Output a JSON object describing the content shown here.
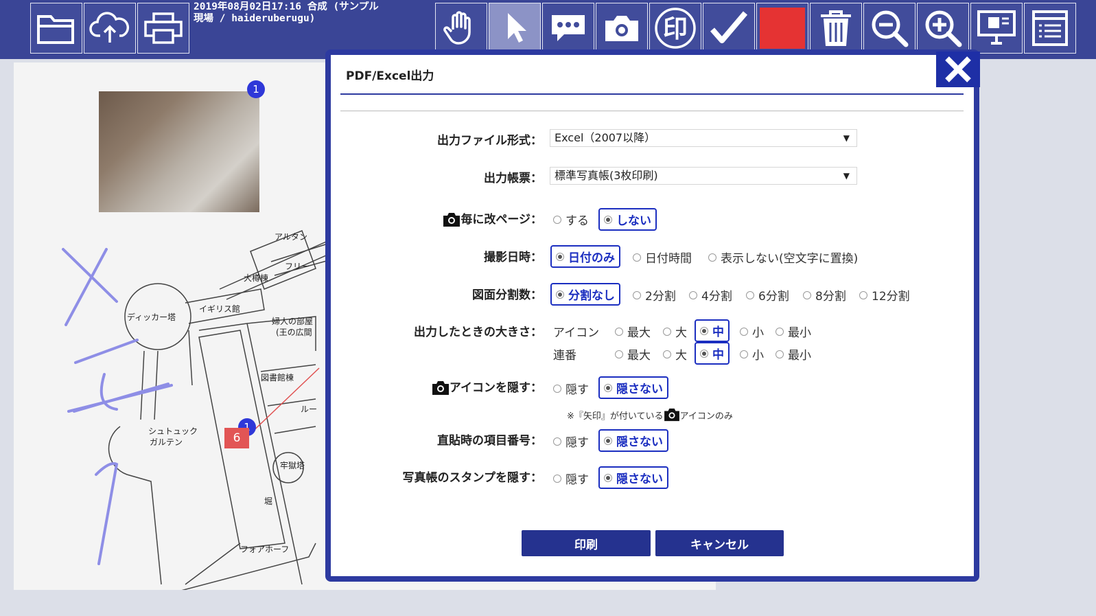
{
  "toolbar": {
    "title_line1": "2019年08月02日17:16 合成 (サンプル",
    "title_line2": "現場 / haideruberugu)",
    "left_tools": [
      "folder-open-icon",
      "cloud-upload-icon",
      "printer-icon"
    ],
    "right_tools": [
      "hand-icon",
      "pointer-icon",
      "comment-icon",
      "camera-icon",
      "stamp-icon",
      "check-icon",
      "color-swatch",
      "trash-icon",
      "zoom-out-icon",
      "zoom-in-icon",
      "monitor-icon",
      "list-icon"
    ],
    "stamp_glyph": "印",
    "swatch_color": "#e53333"
  },
  "canvas": {
    "badge1": "1",
    "badge2": "1",
    "marker6": "6",
    "map_labels": [
      "アルタン",
      "大樽棟",
      "フリー",
      "ディッカー塔",
      "イギリス館",
      "婦人の部屋",
      "(王の広間",
      "図書館棟",
      "ルー",
      "シュトュック",
      "ガルテン",
      "牢獄塔",
      "堀",
      "フォアホーフ"
    ]
  },
  "dialog": {
    "title": "PDF/Excel出力",
    "fields": {
      "file_format": {
        "label": "出力ファイル形式：",
        "value": "Excel（2007以降）"
      },
      "report": {
        "label": "出力帳票：",
        "value": "標準写真帳(3枚印刷)"
      },
      "page_break": {
        "label": "毎に改ページ：",
        "options": [
          "する",
          "しない"
        ],
        "selected": "しない"
      },
      "shot_date": {
        "label": "撮影日時：",
        "options": [
          "日付のみ",
          "日付時間",
          "表示しない(空文字に置換)"
        ],
        "selected": "日付のみ"
      },
      "split": {
        "label": "図面分割数：",
        "options": [
          "分割なし",
          "2分割",
          "4分割",
          "6分割",
          "8分割",
          "12分割"
        ],
        "selected": "分割なし"
      },
      "size": {
        "label": "出力したときの大きさ：",
        "icon_label": "アイコン",
        "number_label": "連番",
        "options": [
          "最大",
          "大",
          "中",
          "小",
          "最小"
        ],
        "icon_selected": "中",
        "number_selected": "中"
      },
      "hide_icon": {
        "label": "アイコンを隠す：",
        "options": [
          "隠す",
          "隠さない"
        ],
        "selected": "隠さない",
        "note_prefix": "※『矢印』が付いている",
        "note_suffix": "アイコンのみ"
      },
      "item_number": {
        "label": "直貼時の項目番号：",
        "options": [
          "隠す",
          "隠さない"
        ],
        "selected": "隠さない"
      },
      "stamp_hide": {
        "label": "写真帳のスタンプを隠す：",
        "options": [
          "隠す",
          "隠さない"
        ],
        "selected": "隠さない"
      }
    },
    "buttons": {
      "print": "印刷",
      "cancel": "キャンセル"
    }
  }
}
